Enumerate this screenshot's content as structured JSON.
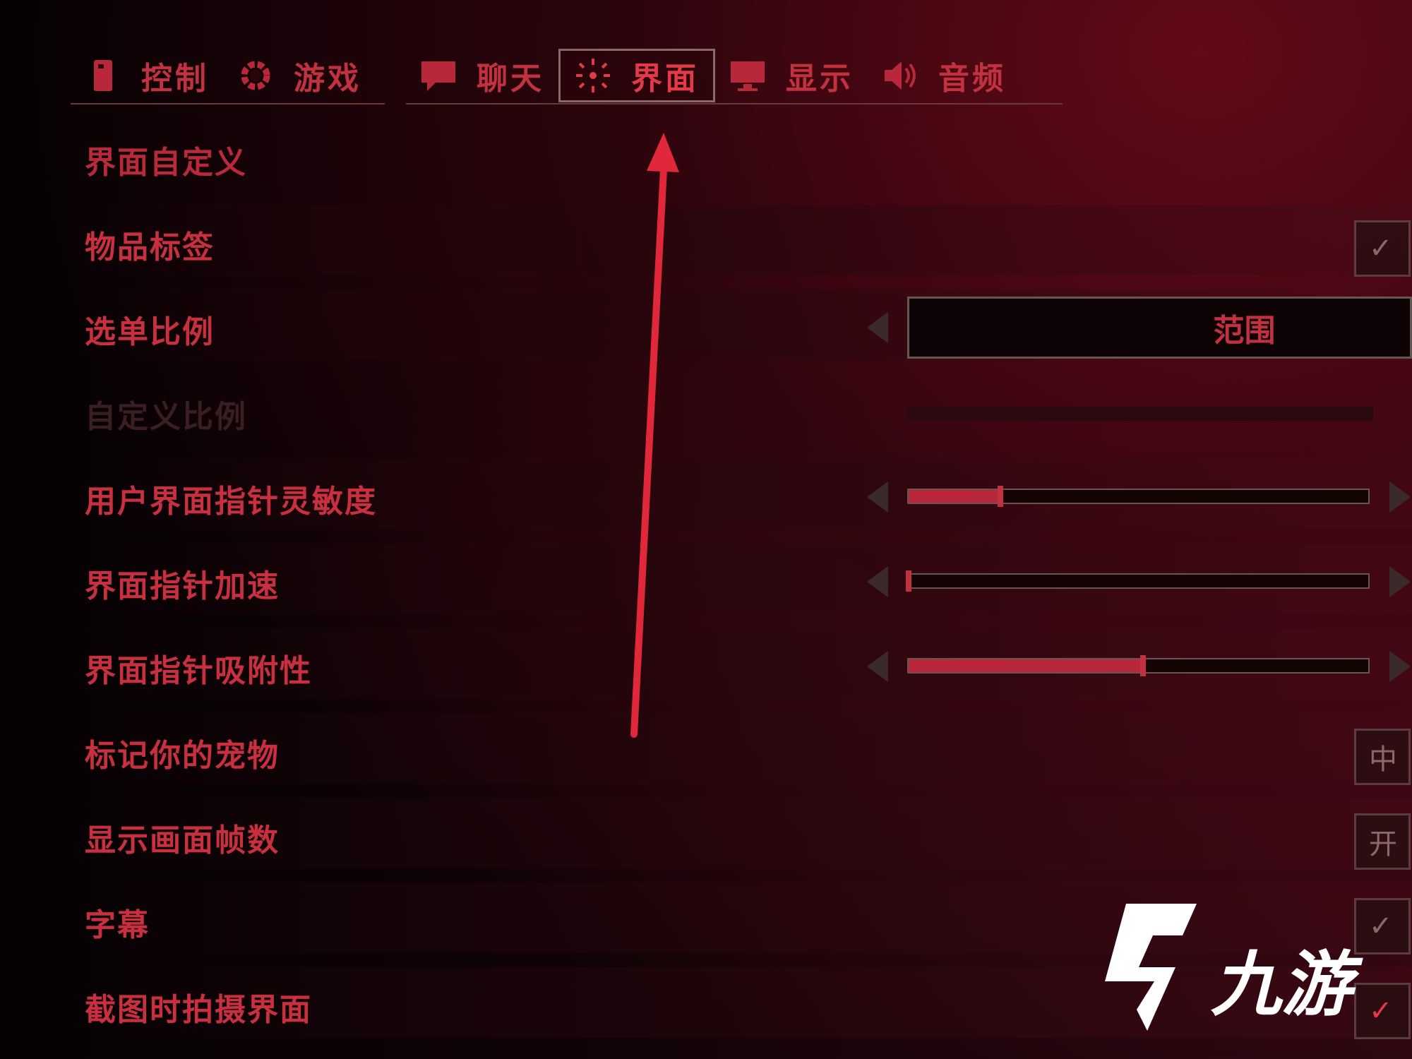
{
  "tabs": [
    {
      "label": "控制",
      "icon": "controller-icon",
      "active": false
    },
    {
      "label": "游戏",
      "icon": "gear-icon",
      "active": false
    },
    {
      "label": "聊天",
      "icon": "chat-bubble-icon",
      "active": false
    },
    {
      "label": "界面",
      "icon": "sun-icon",
      "active": true
    },
    {
      "label": "显示",
      "icon": "monitor-icon",
      "active": false
    },
    {
      "label": "音频",
      "icon": "speaker-icon",
      "active": false
    }
  ],
  "settings": {
    "section_title": "界面自定义",
    "item_labels": {
      "label": "物品标签",
      "checked": true
    },
    "menu_scale": {
      "label": "选单比例",
      "value": "范围"
    },
    "custom_scale": {
      "label": "自定义比例",
      "disabled": true
    },
    "pointer_sensitivity": {
      "label": "用户界面指针灵敏度",
      "value": 0.2
    },
    "pointer_acceleration": {
      "label": "界面指针加速",
      "value": 0.0
    },
    "pointer_stickiness": {
      "label": "界面指针吸附性",
      "value": 0.51
    },
    "mark_pets": {
      "label": "标记你的宠物",
      "value": "中"
    },
    "show_frames": {
      "label": "显示画面帧数",
      "value": "开"
    },
    "subtitles": {
      "label": "字幕",
      "checked": true
    },
    "capture_ui": {
      "label": "截图时拍摄界面",
      "checked": true
    }
  },
  "watermark": {
    "text": "九游"
  },
  "colors": {
    "accent": "#c2313f",
    "background": "#0a0204",
    "border": "#6a5450"
  }
}
